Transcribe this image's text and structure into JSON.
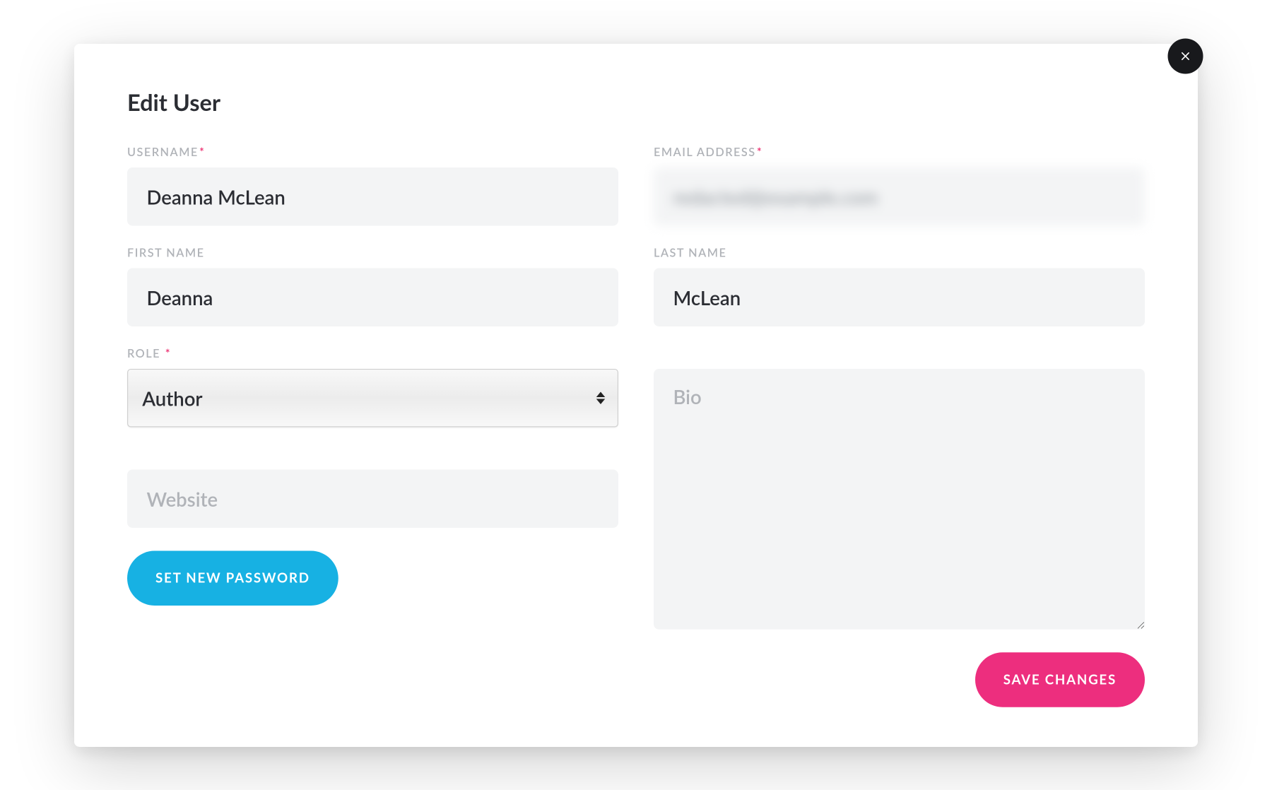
{
  "modal": {
    "title": "Edit User",
    "close_label": "Close"
  },
  "labels": {
    "username": "USERNAME",
    "email": "EMAIL ADDRESS",
    "first_name": "FIRST NAME",
    "last_name": "LAST NAME",
    "role": "ROLE",
    "required_mark": "*"
  },
  "fields": {
    "username": "Deanna McLean",
    "email": "redacted@example.com",
    "first_name": "Deanna",
    "last_name": "McLean",
    "role_selected": "Author",
    "website": "",
    "bio": ""
  },
  "placeholders": {
    "website": "Website",
    "bio": "Bio"
  },
  "buttons": {
    "set_password": "SET NEW PASSWORD",
    "save": "SAVE CHANGES"
  }
}
